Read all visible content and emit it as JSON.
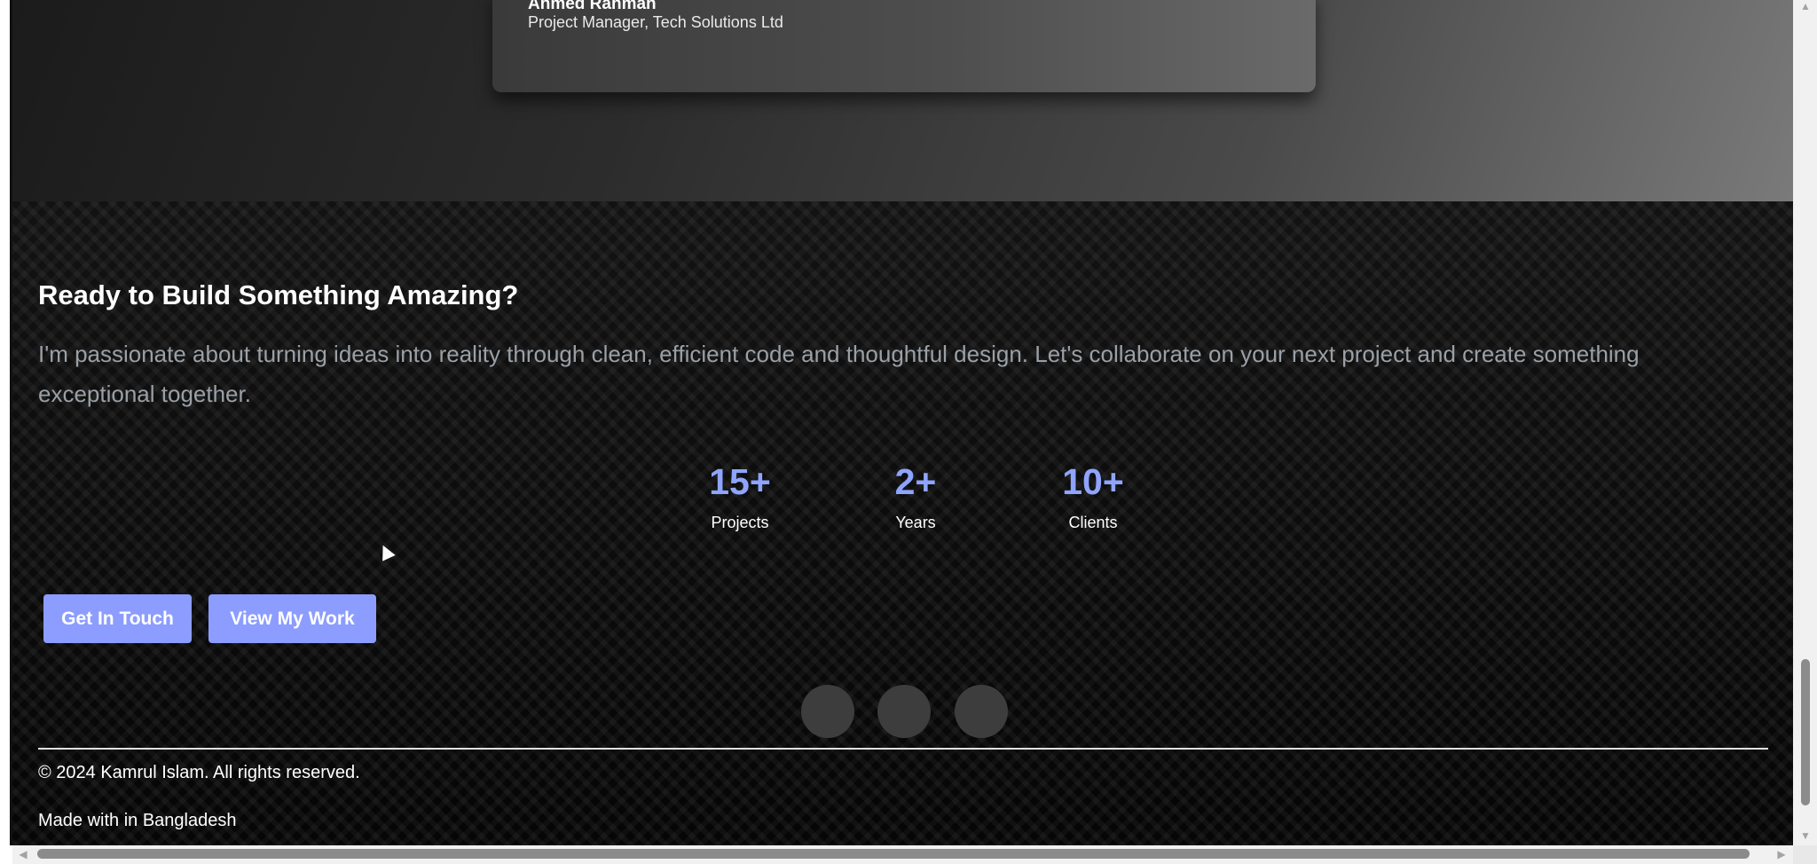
{
  "testimonial": {
    "author_name": "Ahmed Rahman",
    "author_role": "Project Manager, Tech Solutions Ltd"
  },
  "cta": {
    "title": "Ready to Build Something Amazing?",
    "description": "I'm passionate about turning ideas into reality through clean, efficient code and thoughtful design. Let's collaborate on your next project and create something exceptional together."
  },
  "stats": [
    {
      "value": "15+",
      "label": "Projects"
    },
    {
      "value": "2+",
      "label": "Years"
    },
    {
      "value": "10+",
      "label": "Clients"
    }
  ],
  "buttons": {
    "get_in_touch": "Get In Touch",
    "view_my_work": "View My Work"
  },
  "footer": {
    "copyright": "© 2024 Kamrul Islam. All rights reserved.",
    "made_with": "Made with in Bangladesh"
  },
  "scrollbar": {
    "up_arrow": "▲",
    "down_arrow": "▼",
    "left_arrow": "◀",
    "right_arrow": "▶"
  },
  "colors": {
    "accent": "#8fa4ff",
    "button_bg": "#8c9dff",
    "social_circle": "#3d3d3d"
  }
}
